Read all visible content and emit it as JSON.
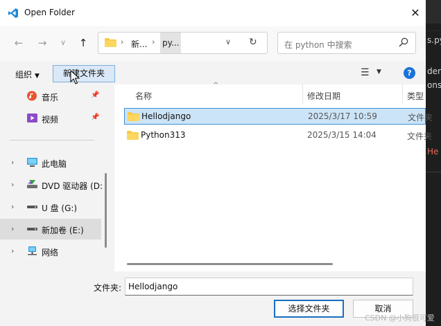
{
  "window": {
    "title": "Open Folder",
    "close": "✕"
  },
  "nav": {
    "back": "←",
    "forward": "→",
    "recent": "∨",
    "up": "↑"
  },
  "address": {
    "segments": [
      "新...",
      "py..."
    ],
    "separator": "›",
    "dropdown": "∨",
    "refresh": "↻"
  },
  "search": {
    "placeholder": "在 python 中搜索"
  },
  "toolbar": {
    "organize": "组织",
    "new_folder": "新建文件夹",
    "help": "?"
  },
  "sidebar": {
    "items": [
      {
        "label": "音乐",
        "icon": "music-icon",
        "pinned": true
      },
      {
        "label": "视频",
        "icon": "video-icon",
        "pinned": true
      },
      {
        "label": "此电脑",
        "icon": "computer-icon"
      },
      {
        "label": "DVD 驱动器 (D:",
        "icon": "dvd-icon"
      },
      {
        "label": "U 盘 (G:)",
        "icon": "usb-drive-icon"
      },
      {
        "label": "新加卷 (E:)",
        "icon": "drive-icon",
        "selected": true
      },
      {
        "label": "网络",
        "icon": "network-icon"
      }
    ],
    "chevron": "›",
    "pin": "📌"
  },
  "files": {
    "columns": [
      "名称",
      "修改日期",
      "类型"
    ],
    "rows": [
      {
        "name": "Hellodjango",
        "date": "2025/3/17 10:59",
        "type": "文件夹",
        "selected": true
      },
      {
        "name": "Python313",
        "date": "2025/3/15 14:04",
        "type": "文件夹"
      }
    ]
  },
  "bottom": {
    "folder_label": "文件夹:",
    "folder_value": "Hellodjango",
    "select_button": "选择文件夹",
    "cancel_button": "取消"
  },
  "background": {
    "text1": "s.py",
    "text2": "der",
    "text3": "ons",
    "text4": "He"
  },
  "watermark": "CSDN @小狗很可爱",
  "colors": {
    "accent": "#1a73d9",
    "folder": "#f7c948",
    "selection": "#cce4f7"
  }
}
